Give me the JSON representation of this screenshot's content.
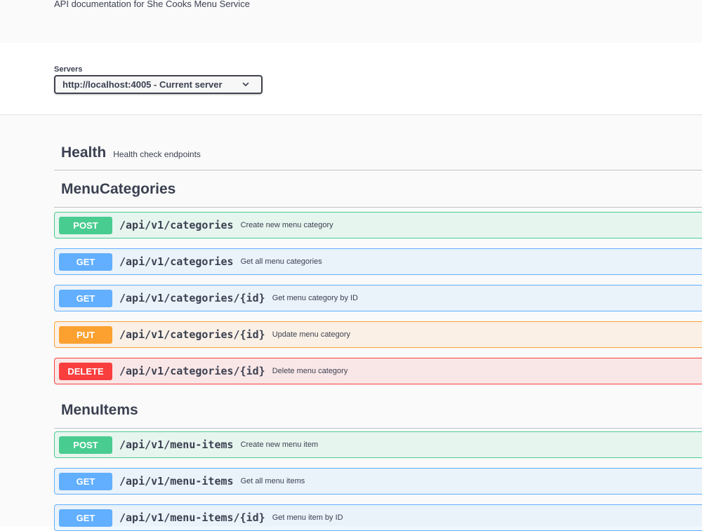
{
  "info": {
    "description": "API documentation for She Cooks Menu Service"
  },
  "servers": {
    "title": "Servers",
    "selected": "http://localhost:4005 - Current server"
  },
  "tags": {
    "health": {
      "name": "Health",
      "description": "Health check endpoints"
    },
    "menu_categories": {
      "name": "MenuCategories",
      "operations": [
        {
          "method": "POST",
          "path": "/api/v1/categories",
          "summary": "Create new menu category"
        },
        {
          "method": "GET",
          "path": "/api/v1/categories",
          "summary": "Get all menu categories"
        },
        {
          "method": "GET",
          "path": "/api/v1/categories/{id}",
          "summary": "Get menu category by ID"
        },
        {
          "method": "PUT",
          "path": "/api/v1/categories/{id}",
          "summary": "Update menu category"
        },
        {
          "method": "DELETE",
          "path": "/api/v1/categories/{id}",
          "summary": "Delete menu category"
        }
      ]
    },
    "menu_items": {
      "name": "MenuItems",
      "operations": [
        {
          "method": "POST",
          "path": "/api/v1/menu-items",
          "summary": "Create new menu item"
        },
        {
          "method": "GET",
          "path": "/api/v1/menu-items",
          "summary": "Get all menu items"
        },
        {
          "method": "GET",
          "path": "/api/v1/menu-items/{id}",
          "summary": "Get menu item by ID"
        }
      ]
    }
  },
  "colors": {
    "post": "#49cc90",
    "get": "#61affe",
    "put": "#fca130",
    "delete": "#f93e3e",
    "text": "#3b4151"
  },
  "icons": {
    "server_dropdown": "chevron-down-icon"
  }
}
